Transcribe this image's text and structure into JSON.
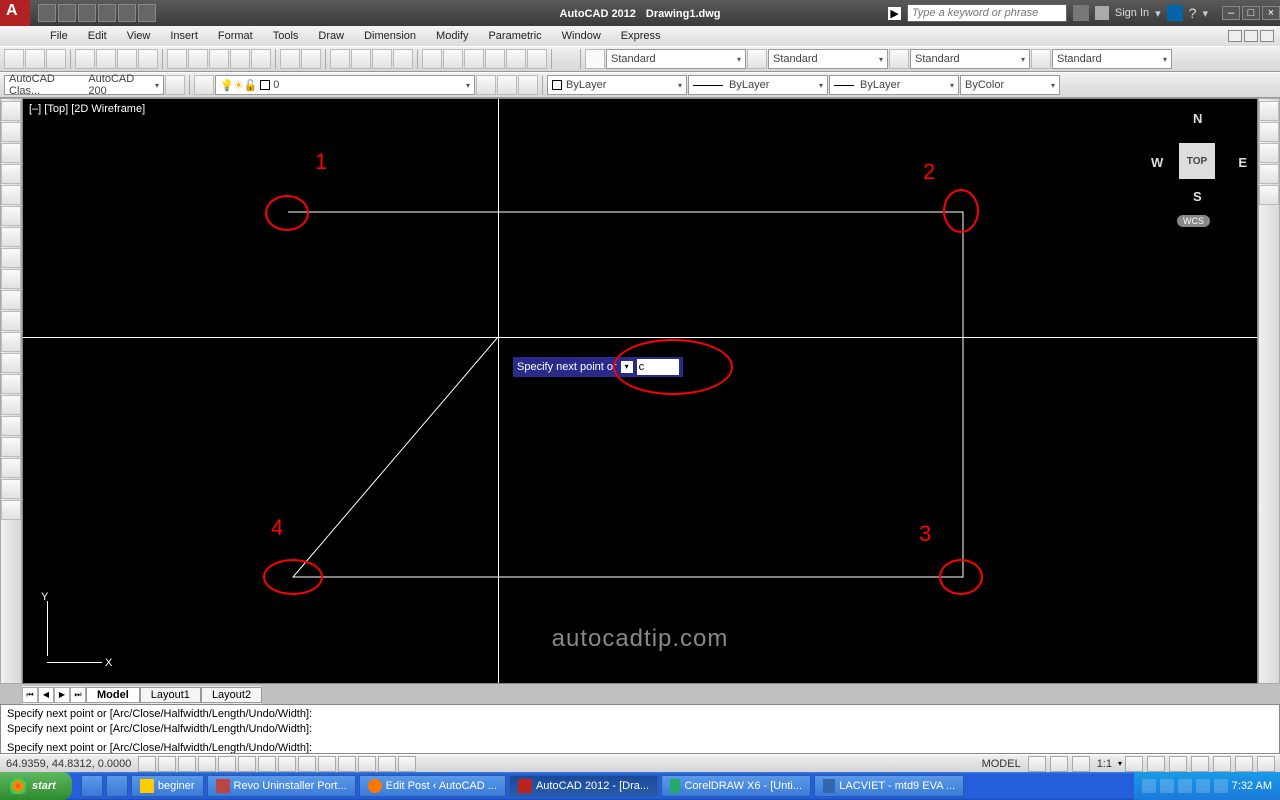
{
  "title": {
    "app": "AutoCAD 2012",
    "doc": "Drawing1.dwg"
  },
  "search": {
    "placeholder": "Type a keyword or phrase"
  },
  "signin": "Sign In",
  "menus": [
    "File",
    "Edit",
    "View",
    "Insert",
    "Format",
    "Tools",
    "Draw",
    "Dimension",
    "Modify",
    "Parametric",
    "Window",
    "Express"
  ],
  "workspace": {
    "combo1": "AutoCAD Clas...",
    "combo2": "AutoCAD 200"
  },
  "layer_combo": "0",
  "style_combos": {
    "text": "Standard",
    "dim": "Standard",
    "table": "Standard",
    "ml": "Standard"
  },
  "props": {
    "layer": "ByLayer",
    "ltype": "ByLayer",
    "lweight": "ByLayer",
    "color": "ByColor"
  },
  "viewport_label": "[–] [Top] [2D Wireframe]",
  "viewcube": {
    "face": "TOP",
    "n": "N",
    "s": "S",
    "e": "E",
    "w": "W",
    "wcs": "WCS"
  },
  "ucs": {
    "x": "X",
    "y": "Y"
  },
  "dyn_prompt": {
    "text": "Specify next point or",
    "value": "c"
  },
  "annotations": {
    "p1": "1",
    "p2": "2",
    "p3": "3",
    "p4": "4"
  },
  "watermark": "autocadtip.com",
  "sheet_tabs": {
    "model": "Model",
    "l1": "Layout1",
    "l2": "Layout2"
  },
  "cmd": {
    "l1": "Specify next point or [Arc/Close/Halfwidth/Length/Undo/Width]:",
    "l2": "Specify next point or [Arc/Close/Halfwidth/Length/Undo/Width]:",
    "l3": "Specify next point or [Arc/Close/Halfwidth/Length/Undo/Width]:"
  },
  "status": {
    "coords": "64.9359, 44.8312, 0.0000",
    "model": "MODEL",
    "scale": "1:1"
  },
  "taskbar": {
    "start": "start",
    "items": [
      "beginer",
      "Revo Uninstaller Port...",
      "Edit Post ‹ AutoCAD ...",
      "AutoCAD 2012 - [Dra...",
      "CorelDRAW X6 - [Unti...",
      "LACVIET - mtd9 EVA ..."
    ],
    "time": "7:32 AM"
  }
}
